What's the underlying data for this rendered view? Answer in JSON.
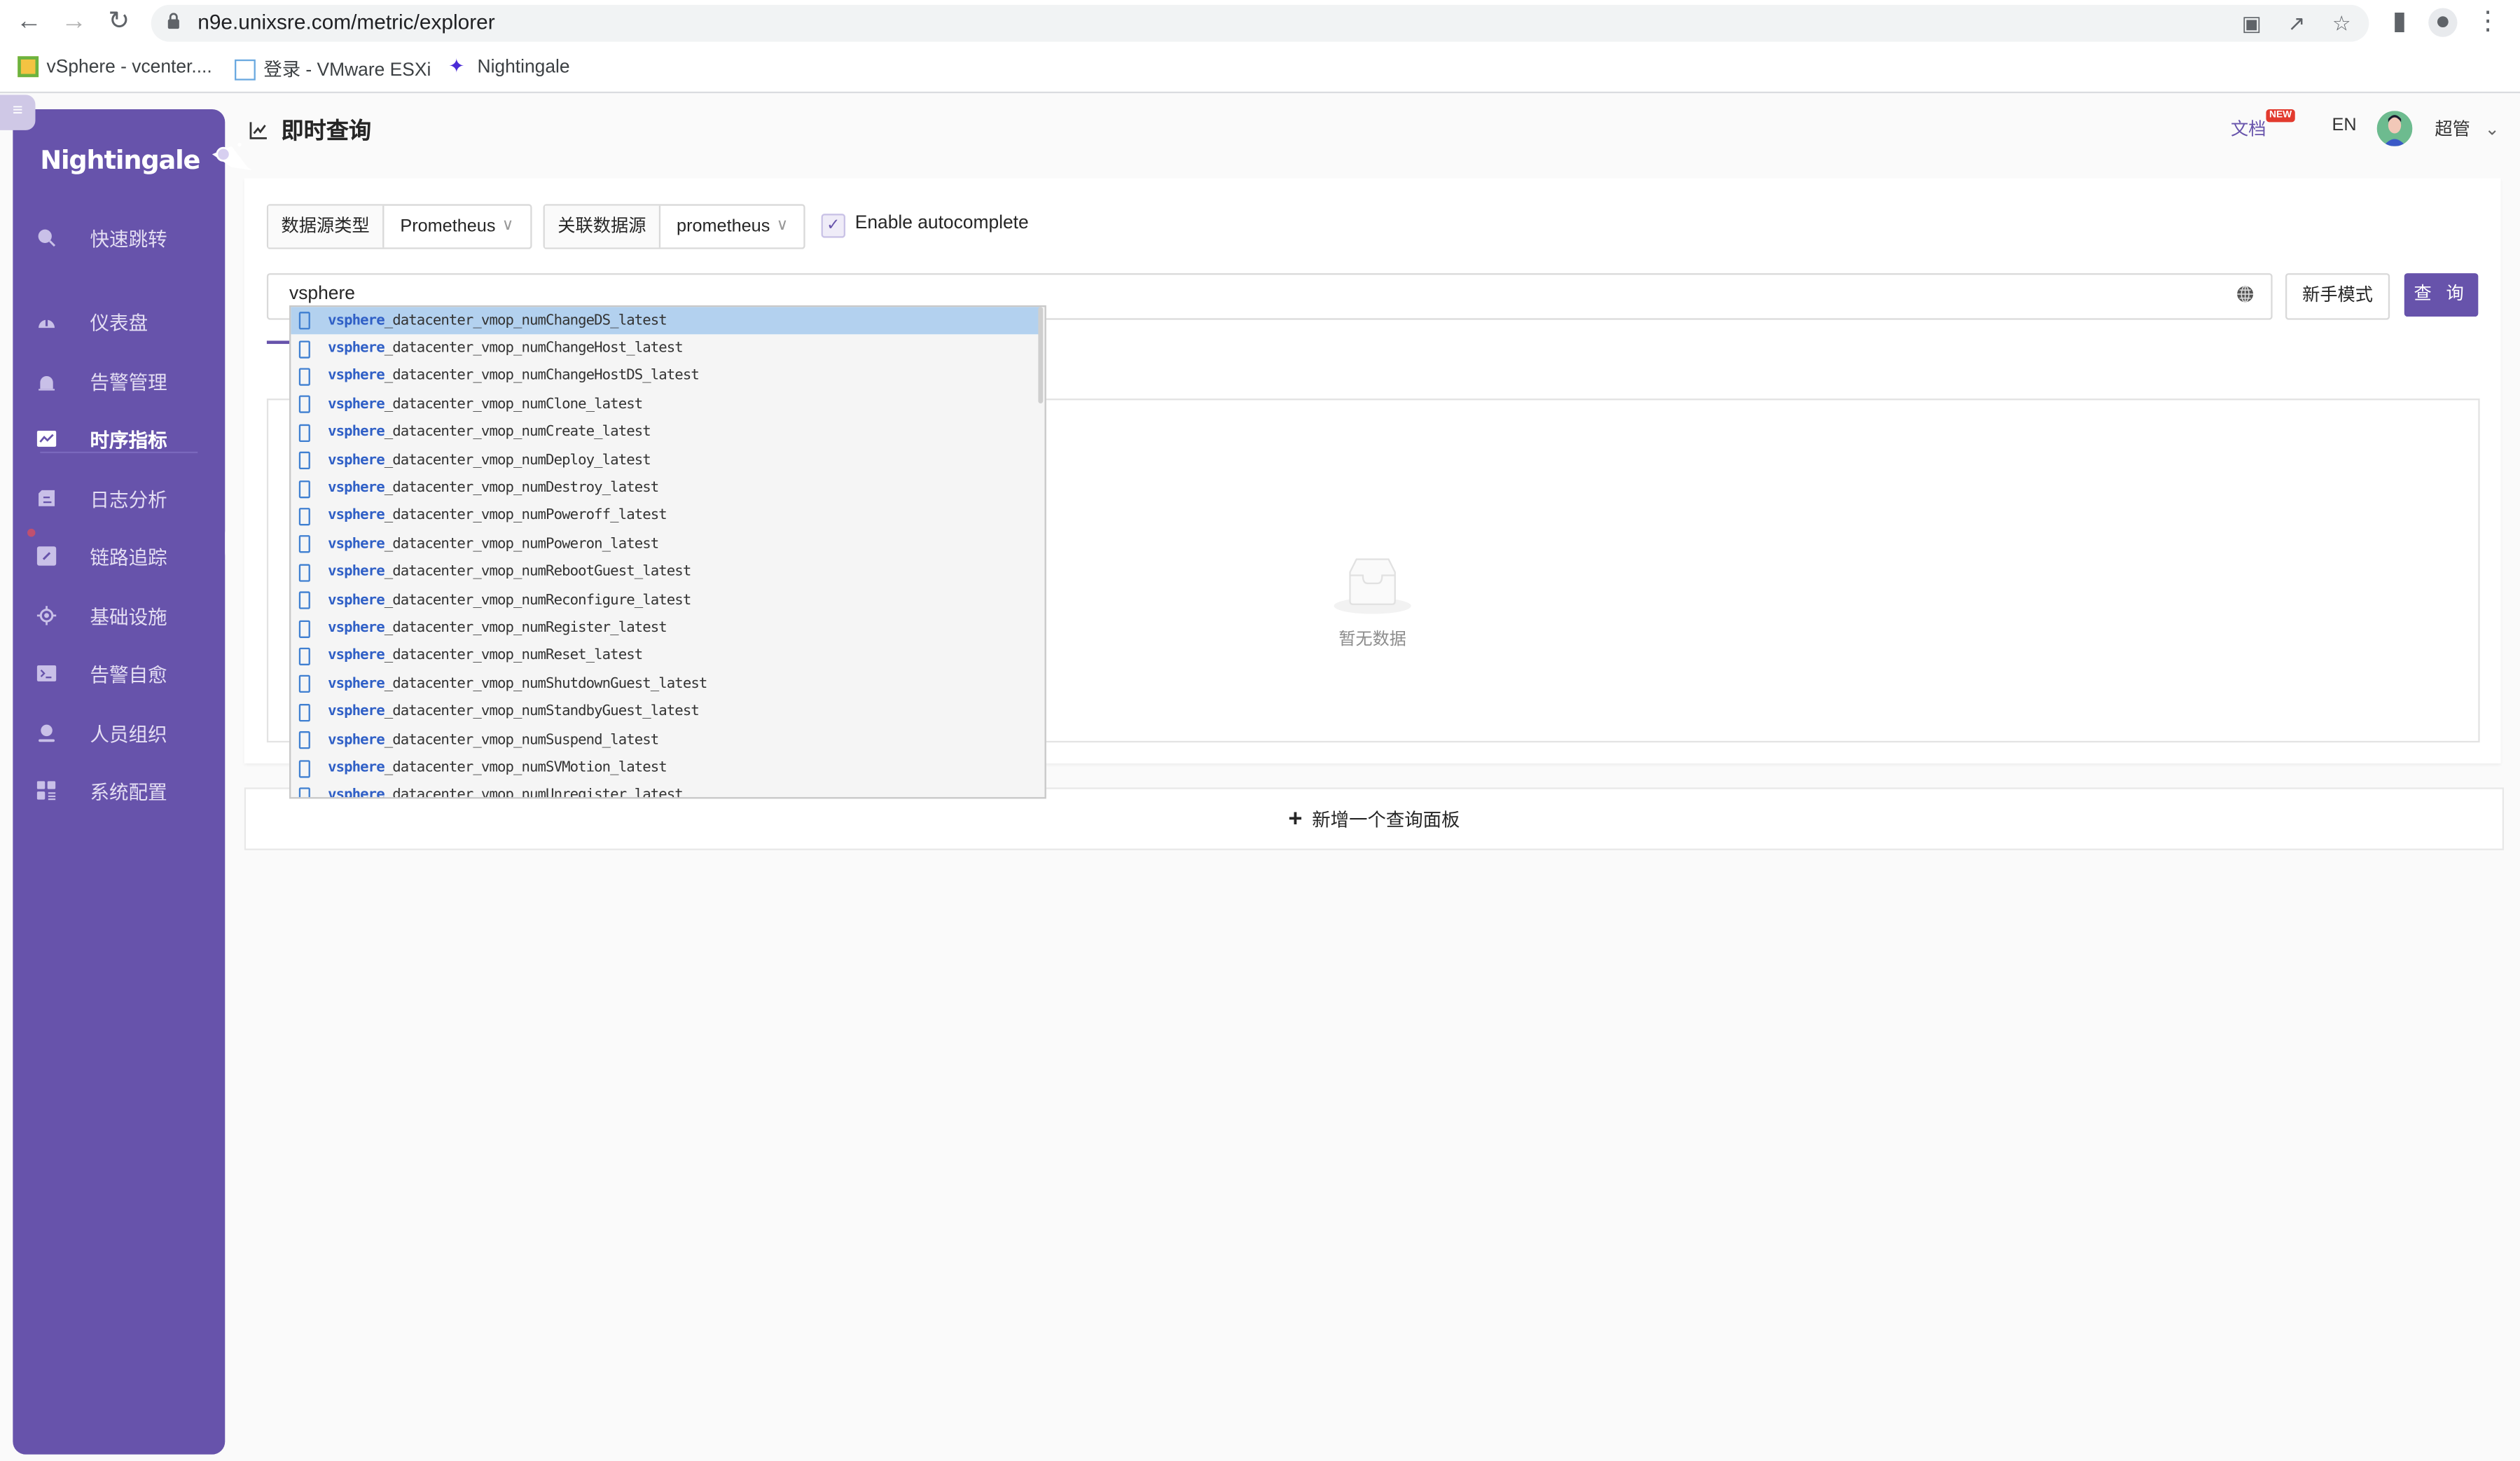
{
  "browser": {
    "url": "n9e.unixsre.com/metric/explorer",
    "bookmarks": [
      {
        "label": "vSphere - vcenter....",
        "icon": "vsphere-icon"
      },
      {
        "label": "登录 - VMware ESXi",
        "icon": "esxi-icon"
      },
      {
        "label": "Nightingale",
        "icon": "nightingale-icon"
      }
    ]
  },
  "app": {
    "logo_text": "Nightingale",
    "sidebar": {
      "items": [
        {
          "label": "快速跳转",
          "icon": "search-icon",
          "active": false
        },
        {
          "label": "仪表盘",
          "icon": "dashboard-icon",
          "active": false
        },
        {
          "label": "告警管理",
          "icon": "alarm-icon",
          "active": false
        },
        {
          "label": "时序指标",
          "icon": "chart-line-icon",
          "active": true
        },
        {
          "label": "日志分析",
          "icon": "log-icon",
          "active": false
        },
        {
          "label": "链路追踪",
          "icon": "link-icon",
          "active": false
        },
        {
          "label": "基础设施",
          "icon": "target-icon",
          "active": false
        },
        {
          "label": "告警自愈",
          "icon": "terminal-icon",
          "active": false
        },
        {
          "label": "人员组织",
          "icon": "user-icon",
          "active": false
        },
        {
          "label": "系统配置",
          "icon": "settings-grid-icon",
          "active": false
        }
      ]
    },
    "header": {
      "title": "即时查询",
      "docs_label": "文档",
      "docs_badge": "NEW",
      "lang_label": "EN",
      "user_name": "超管"
    },
    "query": {
      "datasource_type_label": "数据源类型",
      "datasource_type_value": "Prometheus",
      "datasource_label": "关联数据源",
      "datasource_value": "prometheus",
      "autocomplete_label": "Enable autocomplete",
      "autocomplete_checked": true,
      "input_value": "vsphere",
      "novice_mode_label": "新手模式",
      "query_button_label": "查 询"
    },
    "autocomplete": {
      "match": "vsphere",
      "selected_index": 0,
      "items": [
        "_datacenter_vmop_numChangeDS_latest",
        "_datacenter_vmop_numChangeHost_latest",
        "_datacenter_vmop_numChangeHostDS_latest",
        "_datacenter_vmop_numClone_latest",
        "_datacenter_vmop_numCreate_latest",
        "_datacenter_vmop_numDeploy_latest",
        "_datacenter_vmop_numDestroy_latest",
        "_datacenter_vmop_numPoweroff_latest",
        "_datacenter_vmop_numPoweron_latest",
        "_datacenter_vmop_numRebootGuest_latest",
        "_datacenter_vmop_numReconfigure_latest",
        "_datacenter_vmop_numRegister_latest",
        "_datacenter_vmop_numReset_latest",
        "_datacenter_vmop_numShutdownGuest_latest",
        "_datacenter_vmop_numStandbyGuest_latest",
        "_datacenter_vmop_numSuspend_latest",
        "_datacenter_vmop_numSVMotion_latest",
        "_datacenter_vmop_numUnregister_latest"
      ]
    },
    "result": {
      "empty_text": "暂无数据"
    },
    "add_panel_label": "新增一个查询面板",
    "colors": {
      "brand": "#6753ab",
      "selected_row": "#b3d1ef",
      "match_text": "#2f5fc6"
    }
  }
}
